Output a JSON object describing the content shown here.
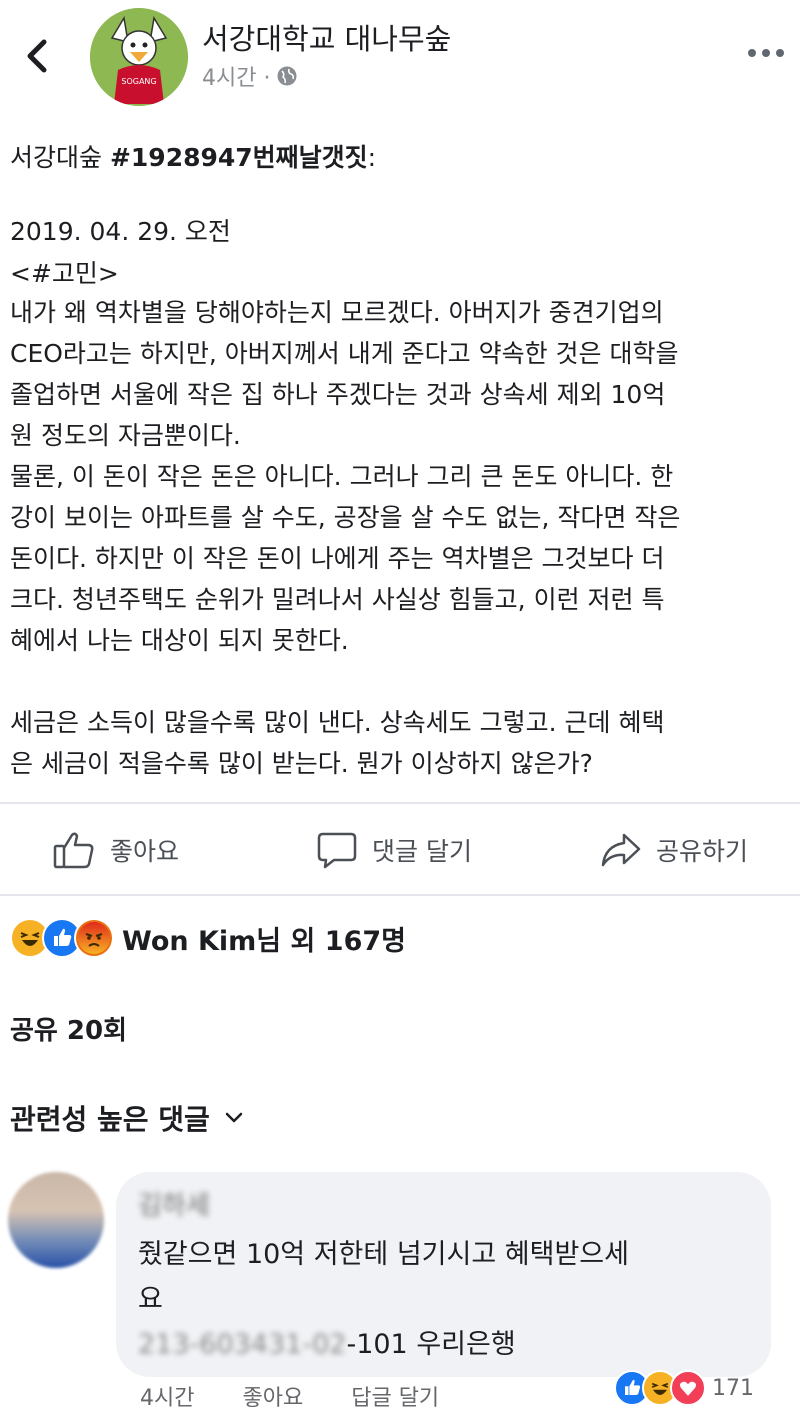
{
  "header": {
    "page_name": "서강대학교 대나무숲",
    "time": "4시간 ·",
    "avatar_text": "SOGANG"
  },
  "post": {
    "title_prefix": "서강대숲 ",
    "title_bold": "#1928947번째날갯짓",
    "title_suffix": ":",
    "date": "2019. 04. 29. 오전",
    "tag": "<#고민>",
    "lines": [
      " 내가 왜 역차별을 당해야하는지 모르겠다. 아버지가 중견기업의",
      "CEO라고는 하지만, 아버지께서 내게 준다고 약속한 것은 대학을",
      "졸업하면 서울에 작은 집 하나 주겠다는 것과 상속세 제외 10억",
      "원 정도의 자금뿐이다.",
      " 물론, 이 돈이 작은 돈은 아니다. 그러나 그리 큰 돈도 아니다. 한",
      "강이 보이는 아파트를 살 수도, 공장을 살 수도 없는, 작다면 작은",
      "돈이다. 하지만 이 작은 돈이 나에게 주는 역차별은 그것보다 더",
      "크다. 청년주택도 순위가 밀려나서 사실상 힘들고, 이런 저런 특",
      "혜에서 나는 대상이 되지 못한다.",
      "",
      " 세금은 소득이 많을수록 많이 낸다. 상속세도 그렇고. 근데 혜택",
      "은 세금이 적을수록 많이 받는다. 뭔가 이상하지 않은가?"
    ]
  },
  "actions": {
    "like": "좋아요",
    "comment": "댓글 달기",
    "share": "공유하기"
  },
  "reactions": {
    "summary": "Won Kim님 외 167명",
    "icons": [
      "haha-icon",
      "like-icon",
      "angry-icon"
    ]
  },
  "shares": "공유 20회",
  "comments_header": "관련성 높은 댓글",
  "comment": {
    "name": "김하세",
    "line1": "줬같으면 10억 저한테 넘기시고 혜택받으세",
    "line2": "요",
    "account_blurred": "213-603431-02",
    "account_suffix": "-101 우리은행",
    "time": "4시간",
    "like": "좋아요",
    "reply": "답글 달기",
    "reaction_count": "171"
  },
  "colors": {
    "accent": "#1877f2",
    "angry": "#e9710f",
    "love": "#f33e58",
    "haha": "#f7b125"
  }
}
